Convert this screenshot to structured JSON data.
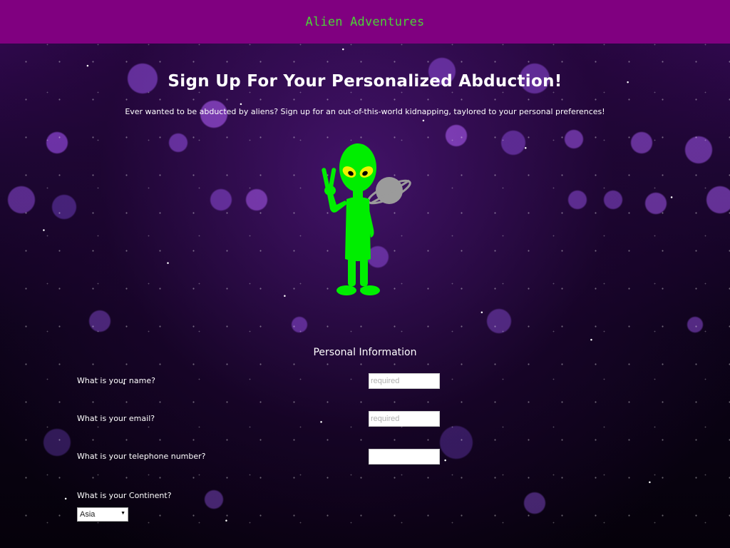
{
  "header": {
    "title": "Alien Adventures"
  },
  "page": {
    "heading": "Sign Up For Your Personalized Abduction!",
    "intro": "Ever wanted to be abducted by aliens? Sign up for an out-of-this-world kidnapping, taylored to your personal preferences!"
  },
  "form": {
    "section_title": "Personal Information",
    "name": {
      "label": "What is your name?",
      "placeholder": "required",
      "value": ""
    },
    "email": {
      "label": "What is your email?",
      "placeholder": "required",
      "value": ""
    },
    "phone": {
      "label": "What is your telephone number?",
      "placeholder": "",
      "value": ""
    },
    "continent": {
      "label": "What is your Continent?",
      "selected": "Asia"
    }
  },
  "icons": {
    "hero": "alien-peace-sign-icon",
    "planet": "saturn-planet-icon",
    "select_arrow": "caret-down-icon"
  },
  "colors": {
    "header_bg": "#800080",
    "brand": "#4cd137",
    "alien_green": "#00ee00",
    "alien_eyes": "#f0f000",
    "planet_gray": "#9b9b9b"
  }
}
